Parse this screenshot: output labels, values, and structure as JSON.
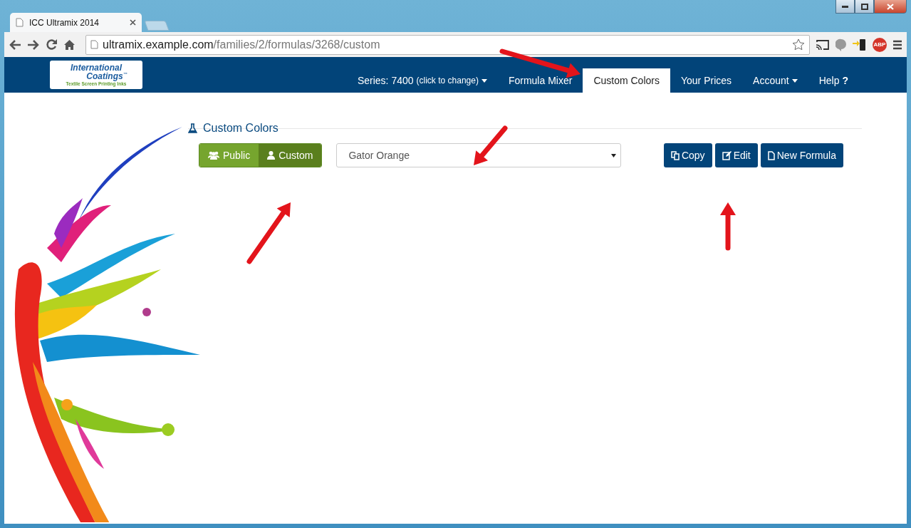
{
  "browser": {
    "tab_title": "ICC Ultramix 2014",
    "url_host": "ultramix.example.com",
    "url_path": "/families/2/formulas/3268/custom",
    "adblock_label": "ABP"
  },
  "logo": {
    "line1": "International",
    "line2": "Coatings",
    "tm": "™",
    "tagline": "Textile Screen Printing Inks"
  },
  "nav": [
    {
      "label": "Series: 7400",
      "sub": "(click to change)",
      "kind": "dropdown",
      "selected": false
    },
    {
      "label": "Formula Mixer",
      "kind": "link",
      "selected": false
    },
    {
      "label": "Custom Colors",
      "kind": "link",
      "selected": true
    },
    {
      "label": "Your Prices",
      "kind": "link",
      "selected": false
    },
    {
      "label": "Account",
      "kind": "dropdown",
      "selected": false
    },
    {
      "label": "Help",
      "icon_text": "?",
      "kind": "help",
      "selected": false
    }
  ],
  "page": {
    "title": "Custom Colors"
  },
  "toggle": [
    {
      "label": "Public",
      "kind": "public",
      "selected": false
    },
    {
      "label": "Custom",
      "kind": "custom",
      "selected": true
    }
  ],
  "formula_select": {
    "value": "Gator Orange"
  },
  "actions": [
    {
      "label": "Copy",
      "kind": "copy"
    },
    {
      "label": "Edit",
      "kind": "edit"
    },
    {
      "label": "New Formula",
      "kind": "new"
    }
  ]
}
